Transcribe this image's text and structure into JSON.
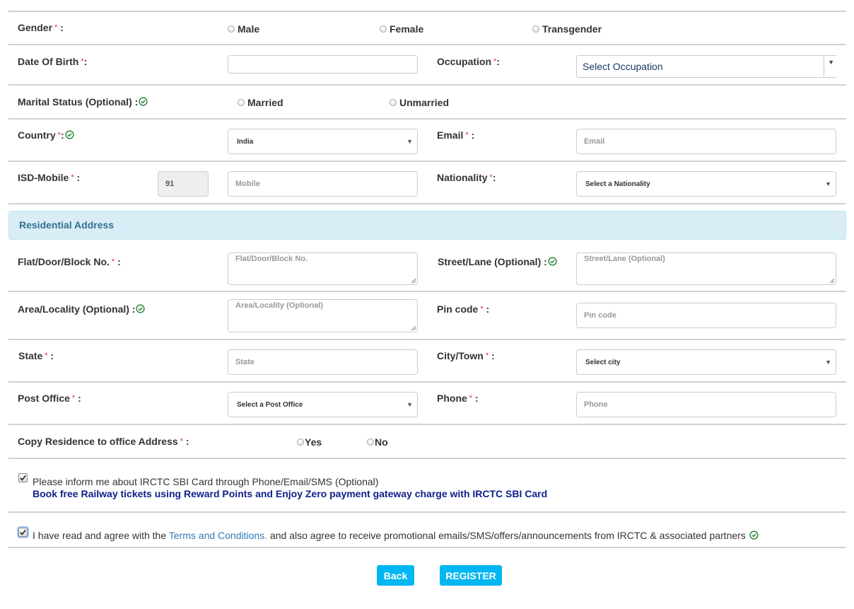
{
  "form": {
    "gender": {
      "label": "Gender",
      "options": [
        "Male",
        "Female",
        "Transgender"
      ]
    },
    "dob": {
      "label": "Date Of Birth",
      "value": ""
    },
    "occupation": {
      "label": "Occupation",
      "selected": "Select Occupation"
    },
    "marital_status": {
      "label": "Marital Status (Optional) :",
      "options": [
        "Married",
        "Unmarried"
      ]
    },
    "country": {
      "label": "Country",
      "selected": "India"
    },
    "email": {
      "label": "Email",
      "placeholder": "Email"
    },
    "isd_mobile": {
      "label": "ISD-Mobile",
      "isd_value": "91",
      "mobile_placeholder": "Mobile"
    },
    "nationality": {
      "label": "Nationality",
      "selected": "Select a Nationality"
    }
  },
  "residential_address": {
    "heading": "Residential Address",
    "flat": {
      "label": "Flat/Door/Block No.",
      "placeholder": "Flat/Door/Block No."
    },
    "street": {
      "label": "Street/Lane (Optional) :",
      "placeholder": "Street/Lane (Optional)"
    },
    "area": {
      "label": "Area/Locality (Optional) :",
      "placeholder": "Area/Locality (Optional)"
    },
    "pincode": {
      "label": "Pin code",
      "placeholder": "Pin code"
    },
    "state": {
      "label": "State",
      "placeholder": "State"
    },
    "city": {
      "label": "City/Town",
      "selected": "Select city"
    },
    "post_office": {
      "label": "Post Office",
      "selected": "Select a Post Office"
    },
    "phone": {
      "label": "Phone",
      "placeholder": "Phone"
    },
    "copy_address": {
      "label": "Copy Residence to office Address",
      "options": [
        "Yes",
        "No"
      ]
    }
  },
  "consents": {
    "sbi_card": {
      "checked": true,
      "text": "Please inform me about IRCTC SBI Card through Phone/Email/SMS (Optional)",
      "promo": "Book free Railway tickets using Reward Points and Enjoy Zero payment gateway charge with IRCTC SBI Card"
    },
    "terms": {
      "checked": true,
      "prefix": "I have read and agree with the",
      "link": "Terms and Conditions.",
      "suffix": "and also agree to receive promotional emails/SMS/offers/announcements from IRCTC & associated partners"
    }
  },
  "actions": {
    "back": "Back",
    "register": "REGISTER"
  },
  "symbols": {
    "required": "*",
    "colon": ":",
    "caret": "▼"
  },
  "colors": {
    "accent": "#00b7f1",
    "required": "#e03030",
    "section_bg": "#d9edf7",
    "section_text": "#31708f",
    "promo_text": "#10208a",
    "valid_green": "#2e8b3c"
  }
}
